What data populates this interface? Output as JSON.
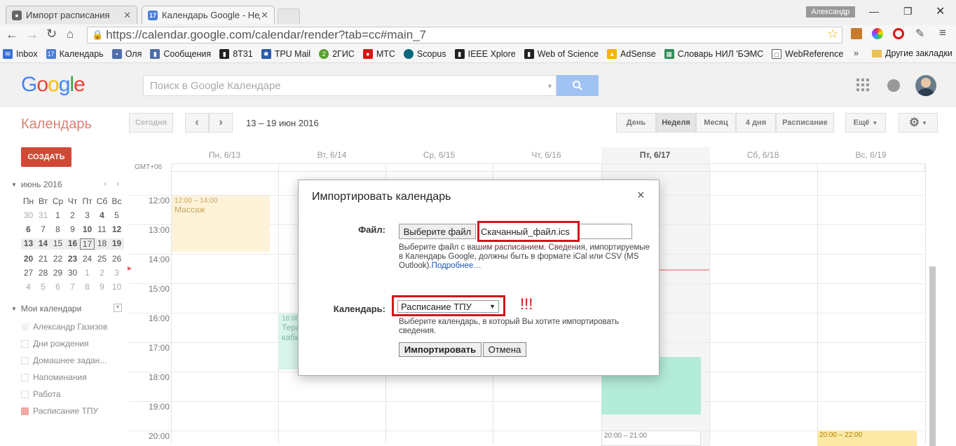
{
  "browser": {
    "tabs": [
      {
        "title": "Импорт расписания",
        "active": false
      },
      {
        "title": "Календарь Google - Неде",
        "active": true
      }
    ],
    "user": "Александр",
    "url": "https://calendar.google.com/calendar/render?tab=cc#main_7",
    "bookmarks": [
      "Inbox",
      "Календарь",
      "Оля",
      "Сообщения",
      "8Т31",
      "TPU Mail",
      "2ГИС",
      "МТС",
      "Scopus",
      "IEEE Xplore",
      "Web of Science",
      "AdSense",
      "Словарь НИЛ 'БЭМС",
      "WebReference"
    ],
    "other_bookmarks": "Другие закладки",
    "more_bookmarks": "»"
  },
  "google": {
    "logo": "Google",
    "search_placeholder": "Поиск в Google Календаре"
  },
  "calendar": {
    "title": "Календарь",
    "today": "Сегодня",
    "range": "13 – 19 июн 2016",
    "views": [
      "День",
      "Неделя",
      "Месяц",
      "4 дня",
      "Расписание"
    ],
    "more": "Ещё",
    "create": "СОЗДАТЬ",
    "gmt": "GMT+06",
    "days": [
      "Пн, 6/13",
      "Вт, 6/14",
      "Ср, 6/15",
      "Чт, 6/16",
      "Пт, 6/17",
      "Сб, 6/18",
      "Вс, 6/19"
    ],
    "times": [
      "12:00",
      "13:00",
      "14:00",
      "15:00",
      "16:00",
      "17:00",
      "18:00",
      "19:00",
      "20:00"
    ],
    "events": [
      {
        "time": "12:00 – 14:00",
        "title": "Массаж"
      },
      {
        "time": "16:00",
        "title": "Тера",
        "title2": "каби"
      },
      {
        "time": "20:00 – 21:00"
      },
      {
        "time": "20:00 – 22:00"
      }
    ],
    "mini": {
      "month": "июнь 2016",
      "weekdays": [
        "Пн",
        "Вт",
        "Ср",
        "Чт",
        "Пт",
        "Сб",
        "Вс"
      ],
      "weeks": [
        [
          "30",
          "31",
          "1",
          "2",
          "3",
          "4",
          "5"
        ],
        [
          "6",
          "7",
          "8",
          "9",
          "10",
          "11",
          "12"
        ],
        [
          "13",
          "14",
          "15",
          "16",
          "17",
          "18",
          "19"
        ],
        [
          "20",
          "21",
          "22",
          "23",
          "24",
          "25",
          "26"
        ],
        [
          "27",
          "28",
          "29",
          "30",
          "1",
          "2",
          "3"
        ],
        [
          "4",
          "5",
          "6",
          "7",
          "8",
          "9",
          "10"
        ]
      ]
    },
    "my_calendars_label": "Мои календари",
    "my_calendars": [
      "Александр Газизов",
      "Дни рождения",
      "Домашнее задан...",
      "Напоминания",
      "Работа",
      "Расписание ТПУ"
    ]
  },
  "dialog": {
    "title": "Импортировать календарь",
    "close": "×",
    "file_label": "Файл:",
    "choose_file": "Выберите файл",
    "file_name": "Скачанный_файл.ics",
    "file_help": "Выберите файл с вашим расписанием. Сведения, импортируемые в Календарь Google, должны быть в формате iCal или CSV (MS Outlook).",
    "more_link": "Подробнее…",
    "calendar_label": "Календарь:",
    "calendar_selected": "Расписание ТПУ",
    "calendar_help": "Выберите календарь, в который Вы хотите импортировать сведения.",
    "exclaim": "!!!",
    "import_button": "Импортировать",
    "cancel_button": "Отмена"
  },
  "colors": {
    "accent_red": "#d2151b",
    "create_button": "#d14836",
    "tpu_calendar": "#f2a8a0",
    "green_event": "#b3ecd8",
    "yellow_event": "#fdf3d9"
  }
}
